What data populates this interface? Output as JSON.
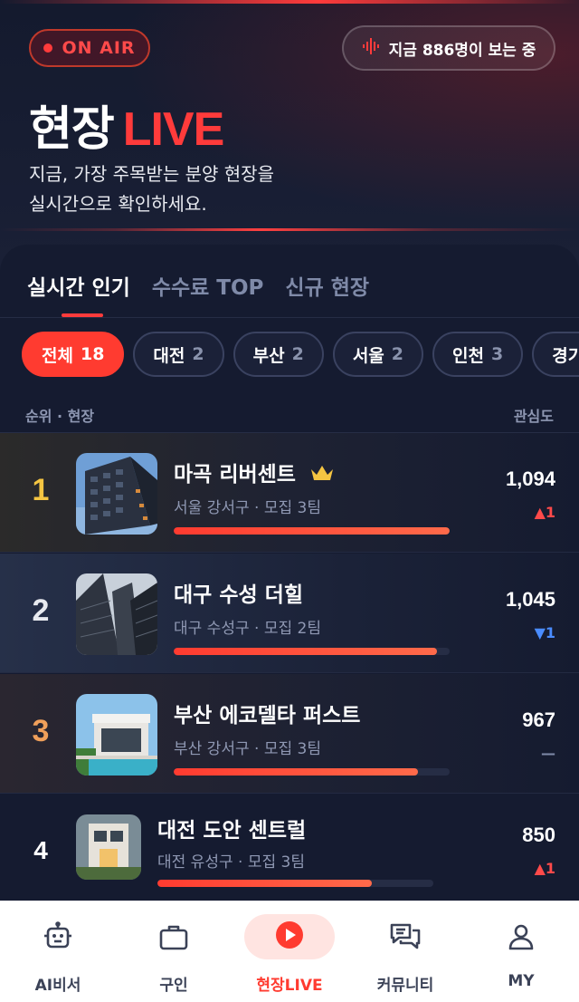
{
  "header": {
    "on_air_label": "ON AIR",
    "viewers_label": "지금 886명이 보는 중",
    "title_main": "현장",
    "title_accent": "LIVE",
    "subtitle_line1": "지금, 가장 주목받는 분양 현장을",
    "subtitle_line2": "실시간으로 확인하세요."
  },
  "tabs": [
    {
      "label": "실시간 인기",
      "active": true
    },
    {
      "label": "수수료 TOP",
      "active": false
    },
    {
      "label": "신규 현장",
      "active": false
    }
  ],
  "chips": [
    {
      "label": "전체",
      "count": "18",
      "active": true
    },
    {
      "label": "대전",
      "count": "2",
      "active": false
    },
    {
      "label": "부산",
      "count": "2",
      "active": false
    },
    {
      "label": "서울",
      "count": "2",
      "active": false
    },
    {
      "label": "인천",
      "count": "3",
      "active": false
    },
    {
      "label": "경기",
      "count": "",
      "active": false
    }
  ],
  "list_header": {
    "left": "순위 · 현장",
    "right": "관심도"
  },
  "items": [
    {
      "rank": "1",
      "name": "마곡 리버센트",
      "meta": "서울 강서구 · 모집 3팀",
      "score": "1,094",
      "delta": "▲1",
      "delta_dir": "up",
      "bar_fraction": 1.0,
      "crown_icon": "crown-icon"
    },
    {
      "rank": "2",
      "name": "대구 수성 더힐",
      "meta": "대구 수성구 · 모집 2팀",
      "score": "1,045",
      "delta": "▼1",
      "delta_dir": "down",
      "bar_fraction": 0.955
    },
    {
      "rank": "3",
      "name": "부산 에코델타 퍼스트",
      "meta": "부산 강서구 · 모집 3팀",
      "score": "967",
      "delta": "—",
      "delta_dir": "same",
      "bar_fraction": 0.884
    },
    {
      "rank": "4",
      "name": "대전 도안 센트럴",
      "meta": "대전 유성구 · 모집 3팀",
      "score": "850",
      "delta": "▲1",
      "delta_dir": "up",
      "bar_fraction": 0.777
    }
  ],
  "colors": {
    "accent": "#ff3b30",
    "rank1": "#f5c542",
    "rank2": "#e8eaf0",
    "rank3": "#f0a05a",
    "background": "#141a2e"
  },
  "nav": [
    {
      "label": "AI비서",
      "icon": "robot-icon",
      "active": false
    },
    {
      "label": "구인",
      "icon": "briefcase-icon",
      "active": false
    },
    {
      "label": "현장LIVE",
      "icon": "play-icon",
      "active": true
    },
    {
      "label": "커뮤니티",
      "icon": "chat-icon",
      "active": false
    },
    {
      "label": "MY",
      "icon": "user-icon",
      "active": false
    }
  ]
}
